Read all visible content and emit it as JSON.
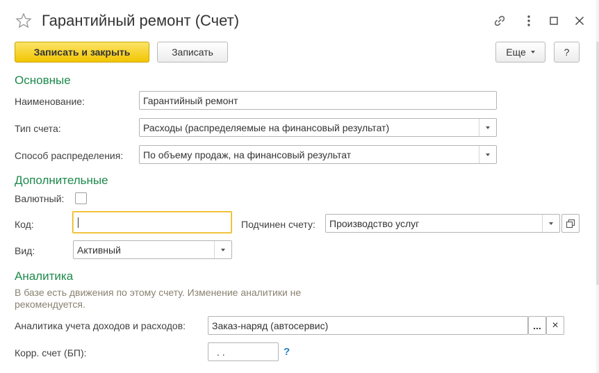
{
  "window": {
    "title": "Гарантийный ремонт (Счет)",
    "icons": [
      "star-icon",
      "link-icon",
      "more-vertical-icon",
      "maximize-icon",
      "close-icon"
    ]
  },
  "toolbar": {
    "save_close_label": "Записать и закрыть",
    "save_label": "Записать",
    "more_label": "Еще",
    "help_label": "?"
  },
  "sections": {
    "main": "Основные",
    "additional": "Дополнительные",
    "analytics": "Аналитика"
  },
  "main": {
    "name_label": "Наименование:",
    "name_value": "Гарантийный ремонт",
    "account_type_label": "Тип счета:",
    "account_type_value": "Расходы (распределяемые на финансовый результат)",
    "distribution_label": "Способ распределения:",
    "distribution_value": "По объему продаж, на финансовый результат"
  },
  "additional": {
    "currency_label": "Валютный:",
    "currency_checked": false,
    "code_label": "Код:",
    "code_value": "",
    "parent_label": "Подчинен счету:",
    "parent_value": "Производство услуг",
    "kind_label": "Вид:",
    "kind_value": "Активный"
  },
  "analytics": {
    "note": "В базе есть движения по этому счету. Изменение аналитики не рекомендуется.",
    "income_label": "Аналитика учета доходов и расходов:",
    "income_value": "Заказ-наряд (автосервис)",
    "select_label": "...",
    "clear_label": "×",
    "corr_label": "Корр. счет (БП):",
    "corr_value": ". .",
    "help_label": "?"
  },
  "colors": {
    "section": "#1d8a4b",
    "primary_button": "#f2c500",
    "focus_border": "#f0b300",
    "note": "#8a8170",
    "help": "#2a7fbf"
  }
}
